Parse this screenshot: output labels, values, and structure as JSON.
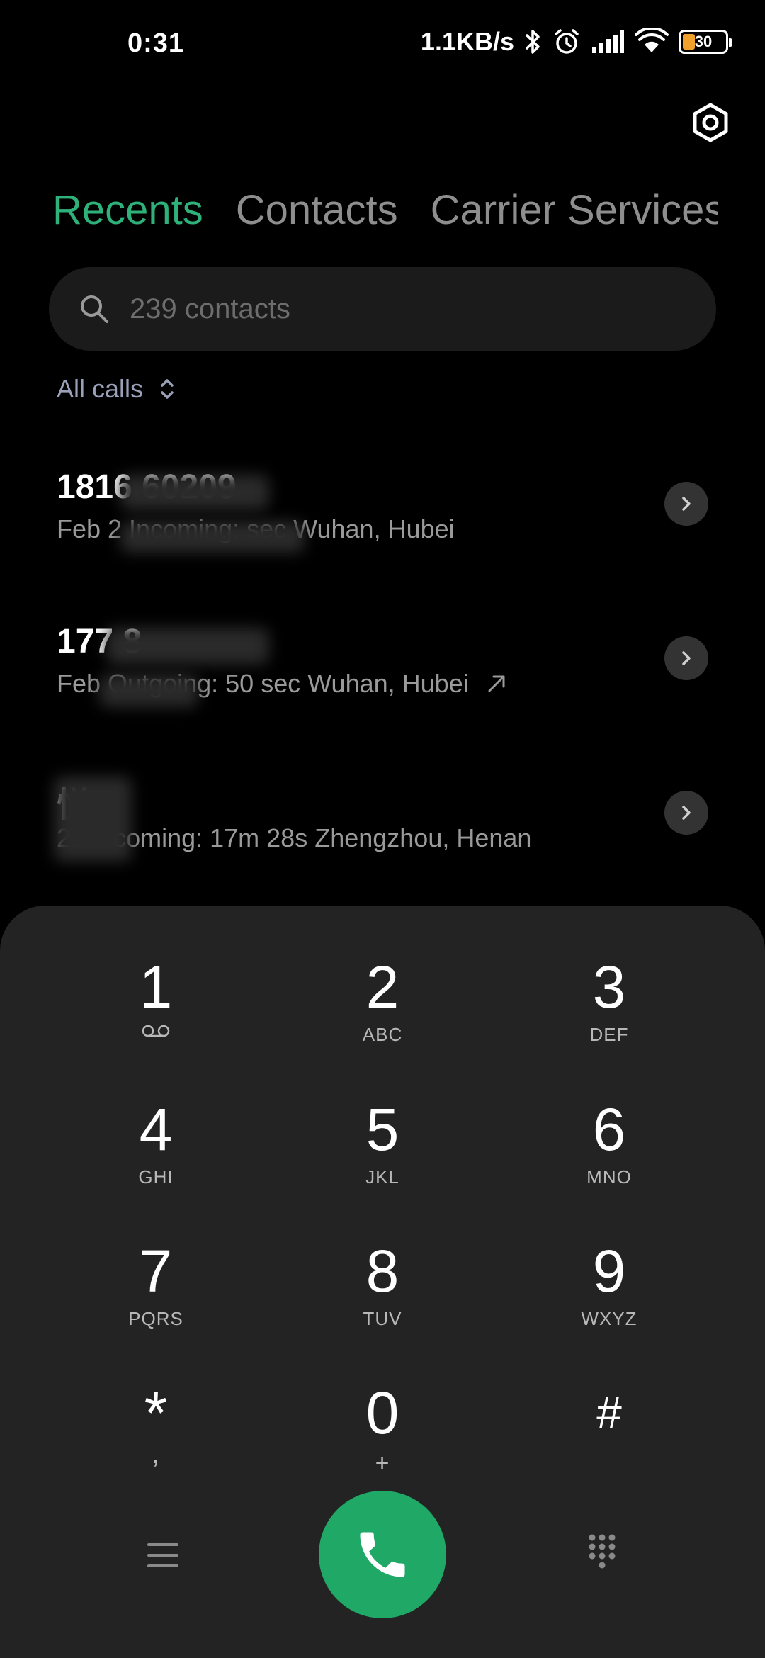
{
  "status_bar": {
    "time": "0:31",
    "net_speed": "1.1KB/s",
    "battery": "30",
    "battery_level": 0.3,
    "icons": [
      "bluetooth-icon",
      "alarm-icon",
      "signal-icon",
      "wifi-icon",
      "battery-icon"
    ]
  },
  "tabs": [
    {
      "label": "Recents",
      "active": true
    },
    {
      "label": "Contacts",
      "active": false
    },
    {
      "label": "Carrier Services",
      "active": false
    }
  ],
  "search": {
    "placeholder": "239 contacts"
  },
  "filter": {
    "label": "All calls"
  },
  "calls": [
    {
      "name": "1816   60209",
      "detail": "Feb 2   Incoming:   sec Wuhan, Hubei",
      "outgoing": false
    },
    {
      "name": "177        8",
      "detail": "Feb    Outgoing: 50 sec Wuhan, Hubei",
      "outgoing": true
    },
    {
      "name": "    悦",
      "detail": "    25 Incoming: 17m 28s Zhengzhou, Henan",
      "outgoing": false
    }
  ],
  "dialpad": {
    "keys": [
      {
        "num": "1",
        "sub": ""
      },
      {
        "num": "2",
        "sub": "ABC"
      },
      {
        "num": "3",
        "sub": "DEF"
      },
      {
        "num": "4",
        "sub": "GHI"
      },
      {
        "num": "5",
        "sub": "JKL"
      },
      {
        "num": "6",
        "sub": "MNO"
      },
      {
        "num": "7",
        "sub": "PQRS"
      },
      {
        "num": "8",
        "sub": "TUV"
      },
      {
        "num": "9",
        "sub": "WXYZ"
      },
      {
        "num": "*",
        "sub": ","
      },
      {
        "num": "0",
        "sub": "+"
      },
      {
        "num": "#",
        "sub": ""
      }
    ]
  },
  "colors": {
    "accent": "#2fb27a",
    "call_button": "#1fa866",
    "dialpad_bg": "#232324"
  }
}
